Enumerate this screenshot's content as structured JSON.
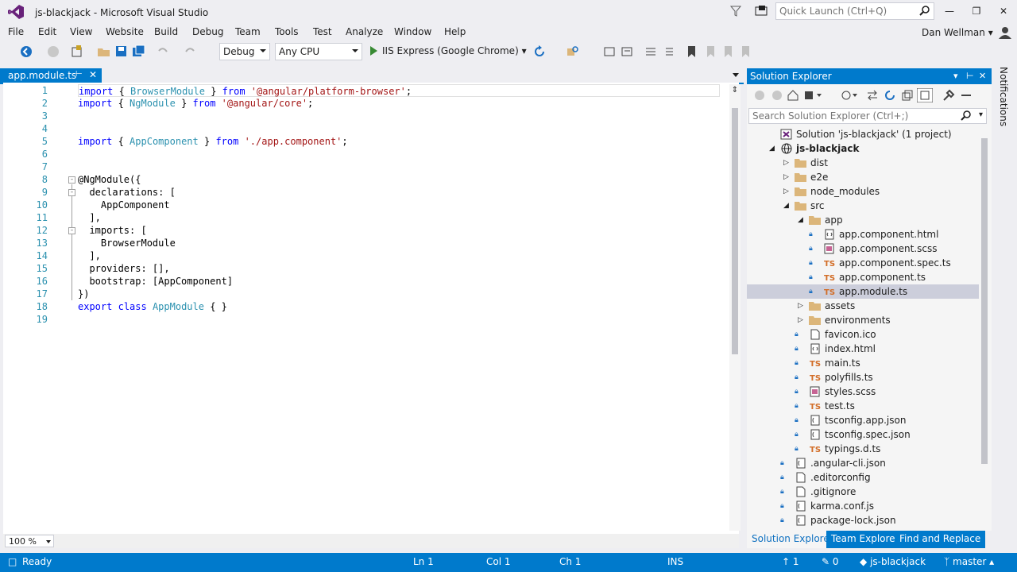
{
  "window": {
    "title": "js-blackjack - Microsoft Visual Studio",
    "quick_launch_placeholder": "Quick Launch (Ctrl+Q)"
  },
  "menu": {
    "items": [
      "File",
      "Edit",
      "View",
      "Website",
      "Build",
      "Debug",
      "Team",
      "Tools",
      "Test",
      "Analyze",
      "Window",
      "Help"
    ],
    "user": "Dan Wellman"
  },
  "toolbar": {
    "configuration": "Debug",
    "platform": "Any CPU",
    "run_target": "IIS Express (Google Chrome)"
  },
  "editor": {
    "tab_label": "app.module.ts",
    "zoom": "100 %",
    "line_numbers": [
      "1",
      "2",
      "3",
      "4",
      "5",
      "6",
      "7",
      "8",
      "9",
      "10",
      "11",
      "12",
      "13",
      "14",
      "15",
      "16",
      "17",
      "18",
      "19"
    ]
  },
  "solution_explorer": {
    "title": "Solution Explorer",
    "search_placeholder": "Search Solution Explorer (Ctrl+;)",
    "tree": [
      {
        "label": "Solution 'js-blackjack' (1 project)",
        "icon": "solution-icon"
      },
      {
        "label": "js-blackjack",
        "icon": "globe-icon"
      },
      {
        "label": "dist",
        "icon": "folder-icon"
      },
      {
        "label": "e2e",
        "icon": "folder-icon"
      },
      {
        "label": "node_modules",
        "icon": "folder-icon"
      },
      {
        "label": "src",
        "icon": "folder-open-icon"
      },
      {
        "label": "app",
        "icon": "folder-open-icon"
      },
      {
        "label": "app.component.html",
        "icon": "html-file-icon"
      },
      {
        "label": "app.component.scss",
        "icon": "scss-file-icon"
      },
      {
        "label": "app.component.spec.ts",
        "icon": "ts-file-icon"
      },
      {
        "label": "app.component.ts",
        "icon": "ts-file-icon"
      },
      {
        "label": "app.module.ts",
        "icon": "ts-file-icon"
      },
      {
        "label": "assets",
        "icon": "folder-icon"
      },
      {
        "label": "environments",
        "icon": "folder-icon"
      },
      {
        "label": "favicon.ico",
        "icon": "image-file-icon"
      },
      {
        "label": "index.html",
        "icon": "html-file-icon"
      },
      {
        "label": "main.ts",
        "icon": "ts-file-icon"
      },
      {
        "label": "polyfills.ts",
        "icon": "ts-file-icon"
      },
      {
        "label": "styles.scss",
        "icon": "scss-file-icon"
      },
      {
        "label": "test.ts",
        "icon": "ts-file-icon"
      },
      {
        "label": "tsconfig.app.json",
        "icon": "json-file-icon"
      },
      {
        "label": "tsconfig.spec.json",
        "icon": "json-file-icon"
      },
      {
        "label": "typings.d.ts",
        "icon": "ts-file-icon"
      },
      {
        "label": ".angular-cli.json",
        "icon": "json-file-icon"
      },
      {
        "label": ".editorconfig",
        "icon": "file-icon"
      },
      {
        "label": ".gitignore",
        "icon": "file-icon"
      },
      {
        "label": "karma.conf.js",
        "icon": "js-file-icon"
      },
      {
        "label": "package-lock.json",
        "icon": "json-file-icon"
      }
    ],
    "tabs": [
      "Solution Explorer",
      "Team Explorer",
      "Find and Replace"
    ]
  },
  "side_panel": {
    "notifications": "Notifications"
  },
  "status_bar": {
    "state": "Ready",
    "line": "Ln 1",
    "col": "Col 1",
    "ch": "Ch 1",
    "mode": "INS",
    "commits_up": "1",
    "pending_changes": "0",
    "repo": "js-blackjack",
    "branch": "master"
  },
  "colors": {
    "accent": "#007acc",
    "keyword": "#0000ff",
    "string": "#a31515",
    "type": "#2b91af",
    "selection": "#cccedb"
  }
}
